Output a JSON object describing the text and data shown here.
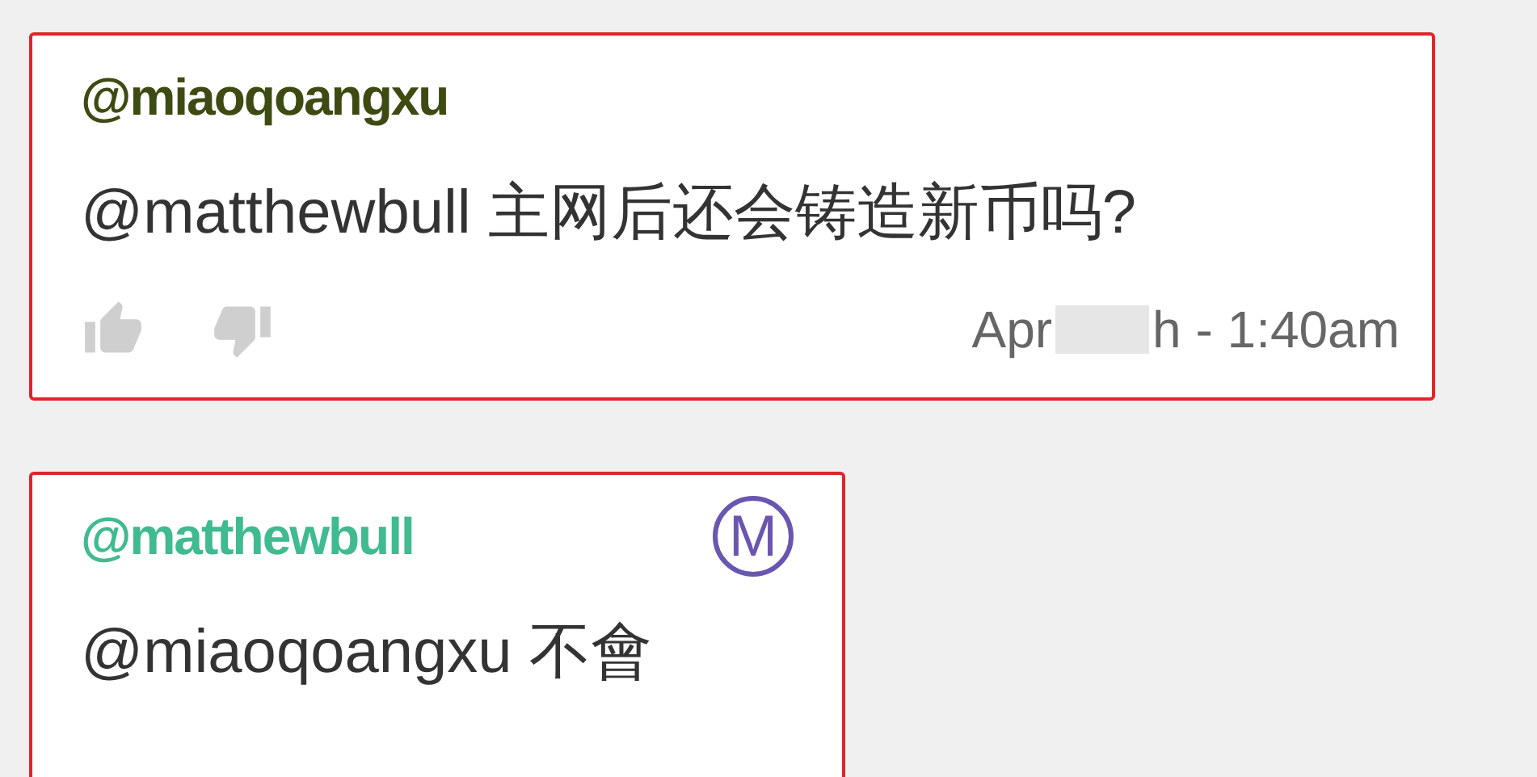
{
  "comments": [
    {
      "author": "@miaoqoangxu",
      "color": "#3d4b12",
      "highlighted": true,
      "text": "@matthewbull 主网后还会铸造新币吗?",
      "date_start": "Apr",
      "date_end": "h - 1:40am"
    },
    {
      "author": "@matthewbull",
      "color": "#3fbb8f",
      "highlighted": true,
      "badge": "M",
      "text": "@miaoqoangxu 不會"
    }
  ]
}
